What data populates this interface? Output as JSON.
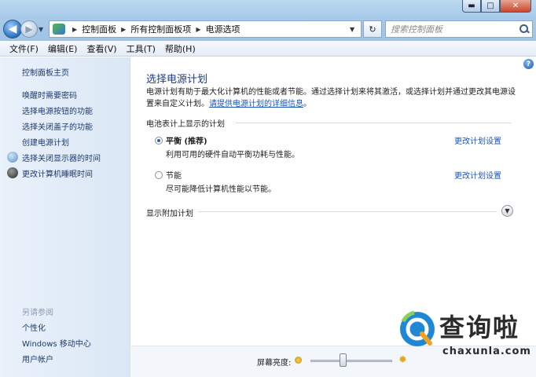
{
  "window": {
    "minimize_glyph": "▬",
    "maximize_glyph": "□",
    "close_glyph": "✕"
  },
  "address": {
    "crumbs": [
      "控制面板",
      "所有控制面板项",
      "电源选项"
    ],
    "search_placeholder": "搜索控制面板"
  },
  "menu": [
    "文件(F)",
    "编辑(E)",
    "查看(V)",
    "工具(T)",
    "帮助(H)"
  ],
  "sidebar": {
    "home": "控制面板主页",
    "links": [
      "唤醒时需要密码",
      "选择电源按钮的功能",
      "选择关闭盖子的功能",
      "创建电源计划",
      "选择关闭显示器的时间",
      "更改计算机睡眠时间"
    ],
    "see_also_title": "另请参阅",
    "see_also": [
      "个性化",
      "Windows 移动中心",
      "用户帐户"
    ]
  },
  "main": {
    "title": "选择电源计划",
    "desc_prefix": "电源计划有助于最大化计算机的性能或者节能。通过选择计划来将其激活，或选择计划并通过更改其电源设置来自定义计划。",
    "desc_link": "请提供电源计划的详细信息",
    "desc_suffix": "。",
    "section_battery": "电池表计上显示的计划",
    "plans": [
      {
        "name": "平衡 (推荐)",
        "desc": "利用可用的硬件自动平衡功耗与性能。",
        "link": "更改计划设置",
        "selected": true
      },
      {
        "name": "节能",
        "desc": "尽可能降低计算机性能以节能。",
        "link": "更改计划设置",
        "selected": false
      }
    ],
    "section_more": "显示附加计划"
  },
  "bottom": {
    "brightness_label": "屏幕亮度:",
    "brightness_level": 0.4
  },
  "watermark": {
    "name": "查询啦",
    "url": "chaxunla.com"
  }
}
